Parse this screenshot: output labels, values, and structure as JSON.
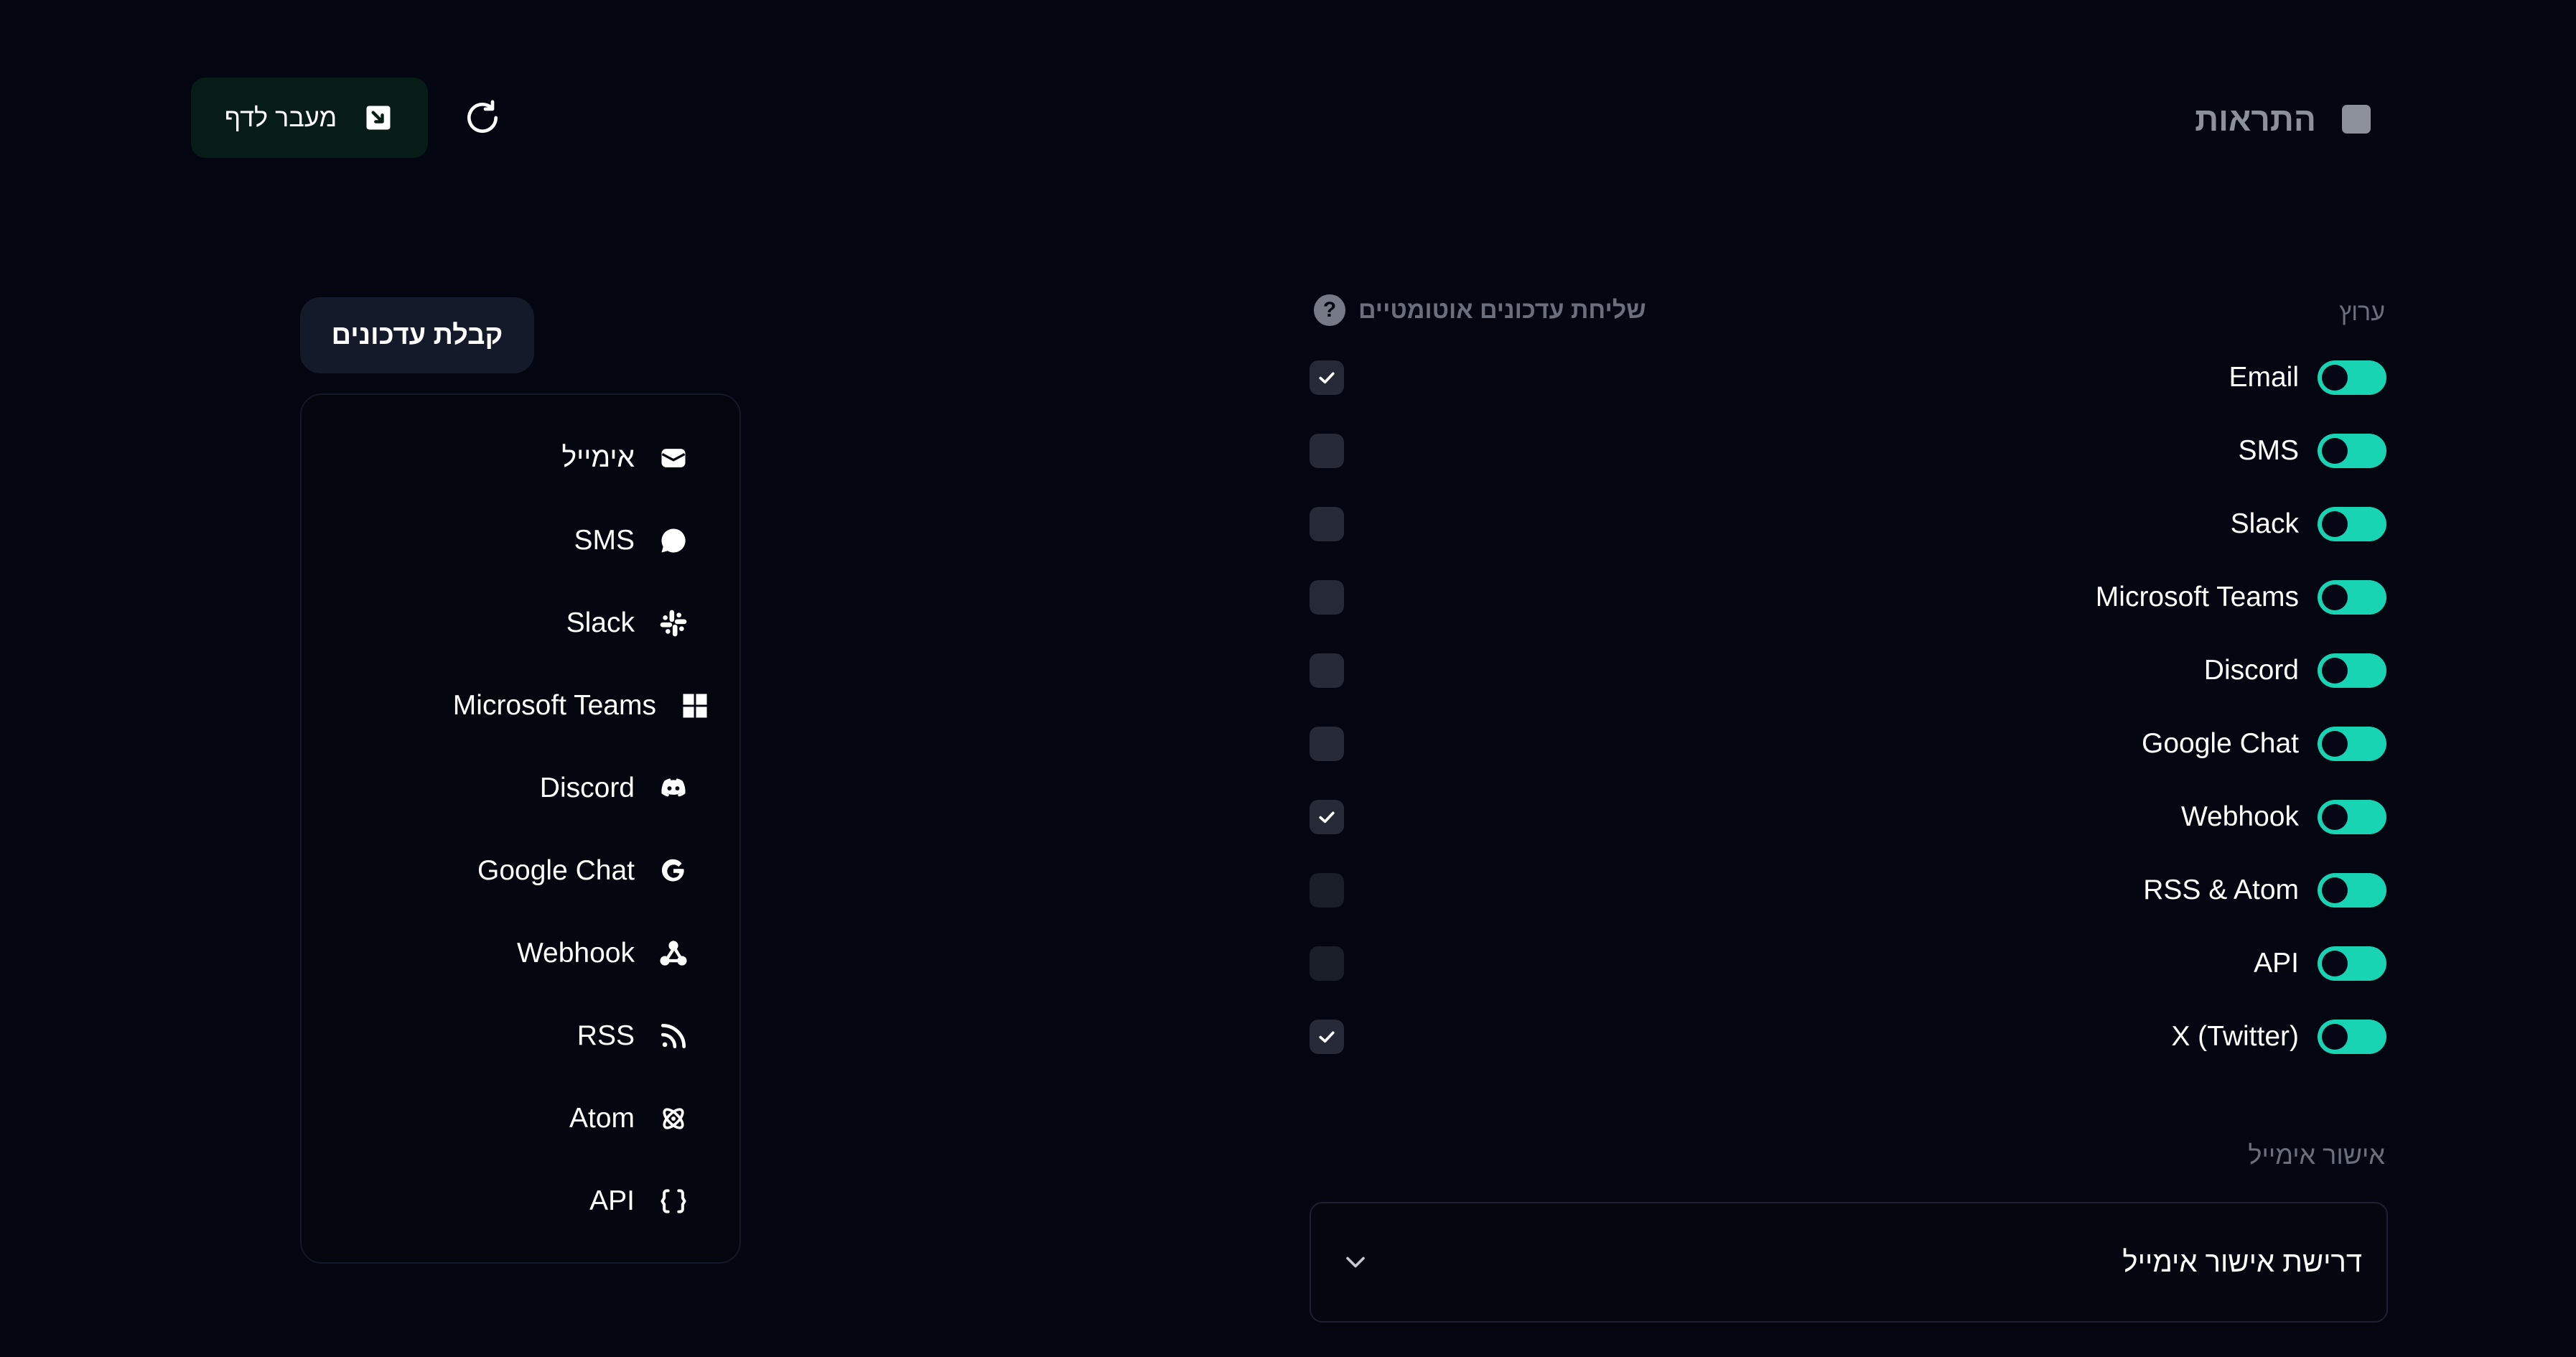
{
  "header": {
    "title": "התראות",
    "goto_label": "מעבר לדף"
  },
  "table": {
    "col_channel": "ערוץ",
    "col_auto": "שליחת עדכונים אוטומטיים",
    "help_symbol": "?",
    "rows": [
      {
        "name": "Email",
        "toggle_on": true,
        "auto_checked": true
      },
      {
        "name": "SMS",
        "toggle_on": true,
        "auto_checked": false
      },
      {
        "name": "Slack",
        "toggle_on": true,
        "auto_checked": false
      },
      {
        "name": "Microsoft Teams",
        "toggle_on": true,
        "auto_checked": false
      },
      {
        "name": "Discord",
        "toggle_on": true,
        "auto_checked": false
      },
      {
        "name": "Google Chat",
        "toggle_on": true,
        "auto_checked": false
      },
      {
        "name": "Webhook",
        "toggle_on": true,
        "auto_checked": true
      },
      {
        "name": "RSS & Atom",
        "toggle_on": true,
        "auto_checked": false
      },
      {
        "name": "API",
        "toggle_on": true,
        "auto_checked": false
      },
      {
        "name": "X (Twitter)",
        "toggle_on": true,
        "auto_checked": true
      }
    ]
  },
  "email_verification": {
    "label": "אישור אימייל",
    "selected": "דרישת אישור אימייל"
  },
  "sidebar": {
    "heading": "קבלת עדכונים",
    "items": [
      {
        "label": "אימייל",
        "icon": "mail-icon"
      },
      {
        "label": "SMS",
        "icon": "chat-bubble-icon"
      },
      {
        "label": "Slack",
        "icon": "slack-icon"
      },
      {
        "label": "Microsoft Teams",
        "icon": "windows-icon"
      },
      {
        "label": "Discord",
        "icon": "discord-icon"
      },
      {
        "label": "Google Chat",
        "icon": "google-icon"
      },
      {
        "label": "Webhook",
        "icon": "webhook-icon"
      },
      {
        "label": "RSS",
        "icon": "rss-icon"
      },
      {
        "label": "Atom",
        "icon": "atom-icon"
      },
      {
        "label": "API",
        "icon": "braces-icon"
      }
    ]
  },
  "colors": {
    "background": "#030611",
    "accent": "#18d4b3",
    "muted_text": "#6b6f7c"
  }
}
